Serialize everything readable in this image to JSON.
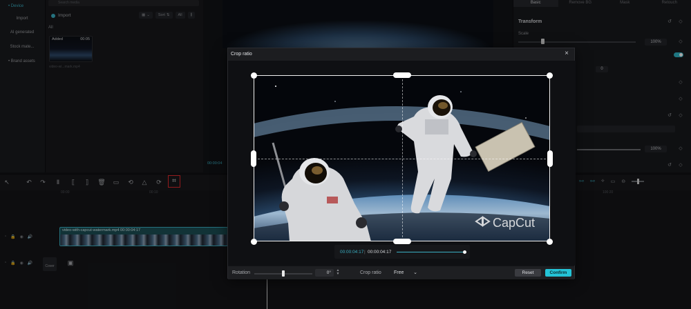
{
  "sidebar": {
    "items": [
      {
        "label": "• Device"
      },
      {
        "label": "Import"
      },
      {
        "label": "AI generated"
      },
      {
        "label": "Stock mate..."
      },
      {
        "label": "• Brand assets"
      }
    ]
  },
  "media": {
    "search_placeholder": "Search media",
    "import_label": "Import",
    "sort_label": "Sort",
    "all_chip": "All",
    "filter_all": "All",
    "clip": {
      "badge": "Added",
      "duration": "00:05",
      "name": "video-wi...mark.mp4"
    }
  },
  "player": {
    "timecode": "00:00:04"
  },
  "properties": {
    "tabs": [
      "Basic",
      "Remove BG",
      "Mask",
      "Retouch"
    ],
    "transform_title": "Transform",
    "scale_label": "Scale",
    "scale_value": "100%",
    "rotation_value": "0",
    "opacity_value": "100%",
    "position_marker": "8"
  },
  "timeline": {
    "ruler": [
      "00:00",
      "00:10",
      "100:20"
    ],
    "clip_label": "video-with-capcut-watermark.mp4  00:00:04:17",
    "cover_label": "Cover"
  },
  "crop_modal": {
    "title": "Crop ratio",
    "watermark": "CapCut",
    "timecode_current": "00:00:04:17",
    "timecode_separator": "|",
    "timecode_total": "00:00:04:17",
    "progress": 1.0,
    "rotation_label": "Rotation",
    "rotation_value": "0°",
    "crop_ratio_label": "Crop ratio",
    "crop_ratio_value": "Free",
    "reset_label": "Reset",
    "confirm_label": "Confirm"
  },
  "colors": {
    "accent": "#24c3d6",
    "highlight_box": "#e0292b",
    "track": "#1d4f55"
  }
}
